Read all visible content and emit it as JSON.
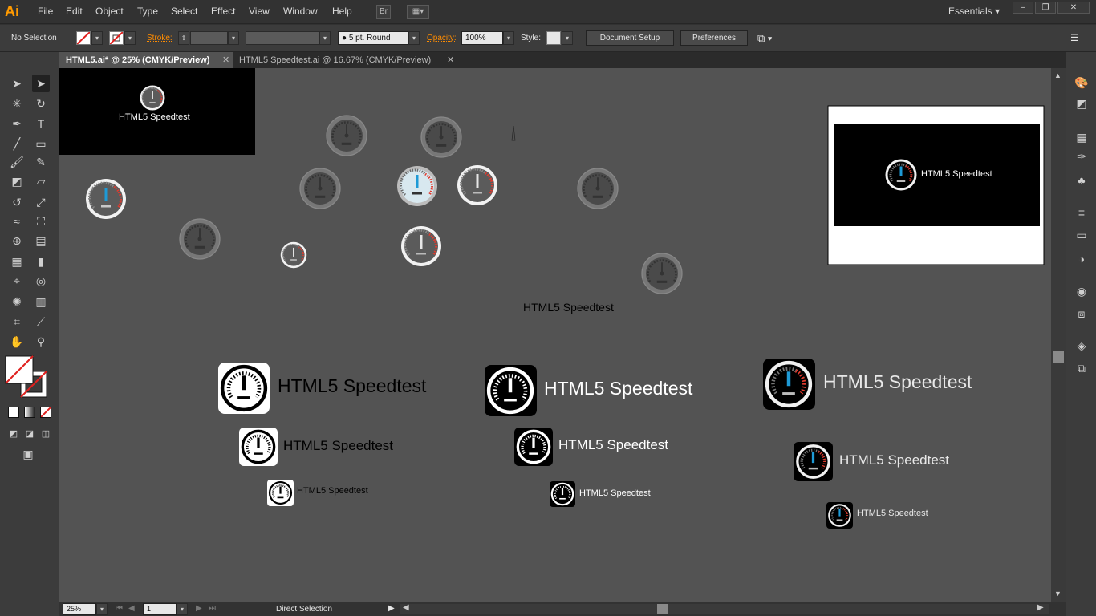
{
  "app": {
    "logo": "Ai",
    "workspace": "Essentials"
  },
  "menu": [
    "File",
    "Edit",
    "Object",
    "Type",
    "Select",
    "Effect",
    "View",
    "Window",
    "Help"
  ],
  "menubar_icons": {
    "bridge": "Br"
  },
  "window_controls": [
    "–",
    "❐",
    "✕"
  ],
  "control_bar": {
    "selection": "No Selection",
    "stroke_label": "Stroke:",
    "brush": "5 pt. Round",
    "opacity_label": "Opacity:",
    "opacity_value": "100%",
    "style_label": "Style:",
    "document_setup": "Document Setup",
    "preferences": "Preferences"
  },
  "tabs": [
    {
      "label": "HTML5.ai* @ 25% (CMYK/Preview)",
      "active": true
    },
    {
      "label": "HTML5 Speedtest.ai @ 16.67% (CMYK/Preview)",
      "active": false
    }
  ],
  "tab_close": "✕",
  "artwork": {
    "brand": "HTML5 Speedtest"
  },
  "status": {
    "zoom": "25%",
    "page": "1",
    "tool": "Direct Selection"
  },
  "colors": {
    "accent": "#ff9a00",
    "gauge_blue": "#1e9ad6",
    "gauge_red": "#e23b2e",
    "canvas": "#535353"
  }
}
